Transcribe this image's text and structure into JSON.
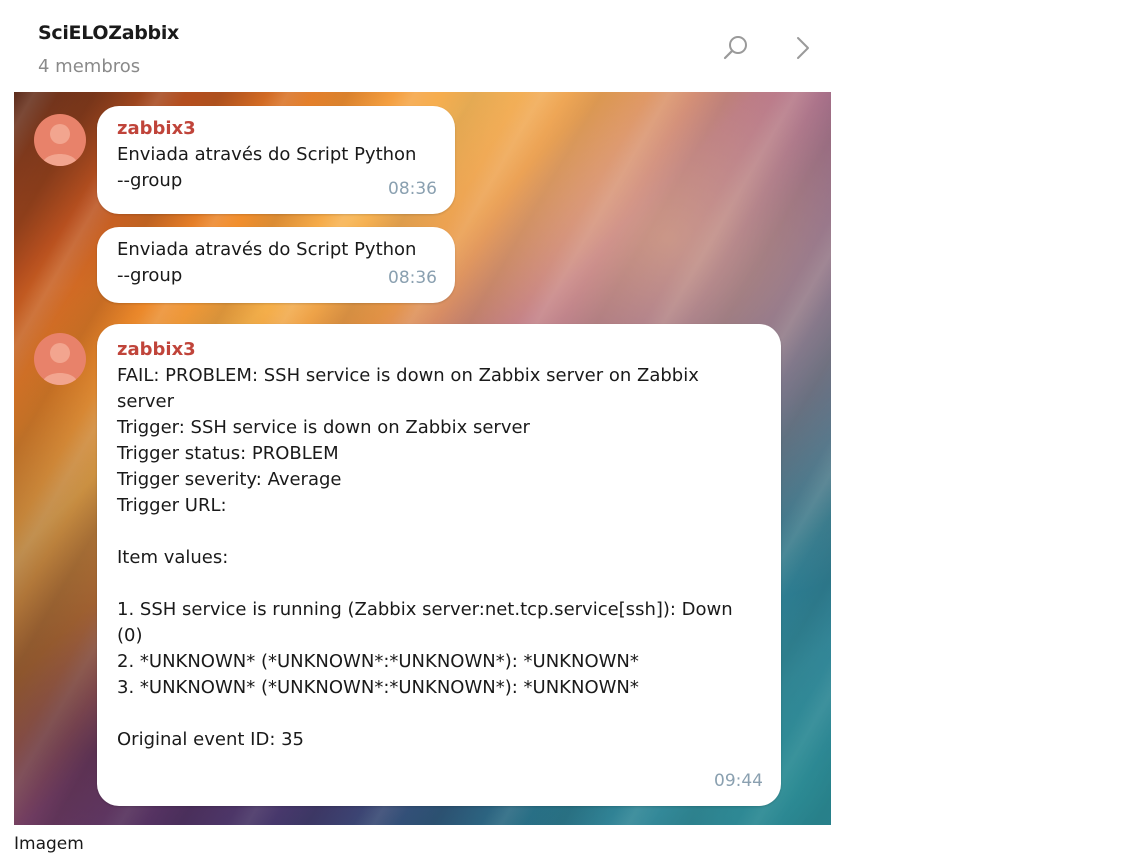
{
  "header": {
    "title": "SciELOZabbix",
    "subtitle": "4 membros",
    "search_icon": "search-icon",
    "forward_icon": "chevron-right-icon"
  },
  "messages": [
    {
      "sender": "zabbix3",
      "text": "Enviada através do Script Python\n--group",
      "time": "08:36"
    },
    {
      "sender": "",
      "text": "Enviada através do Script Python\n--group",
      "time": "08:36"
    },
    {
      "sender": "zabbix3",
      "text": "FAIL: PROBLEM: SSH service is down on Zabbix server on Zabbix\nserver\nTrigger: SSH service is down on Zabbix server\nTrigger status: PROBLEM\nTrigger severity: Average\nTrigger URL:\n\nItem values:\n\n1. SSH service is running (Zabbix server:net.tcp.service[ssh]): Down\n(0)\n2. *UNKNOWN* (*UNKNOWN*:*UNKNOWN*): *UNKNOWN*\n3. *UNKNOWN* (*UNKNOWN*:*UNKNOWN*): *UNKNOWN*\n\nOriginal event ID: 35",
      "time": "09:44"
    }
  ],
  "caption": "Imagem",
  "colors": {
    "sender_name": "#c0443a",
    "avatar": "#e8826a",
    "timestamp": "#8aa0b0"
  }
}
